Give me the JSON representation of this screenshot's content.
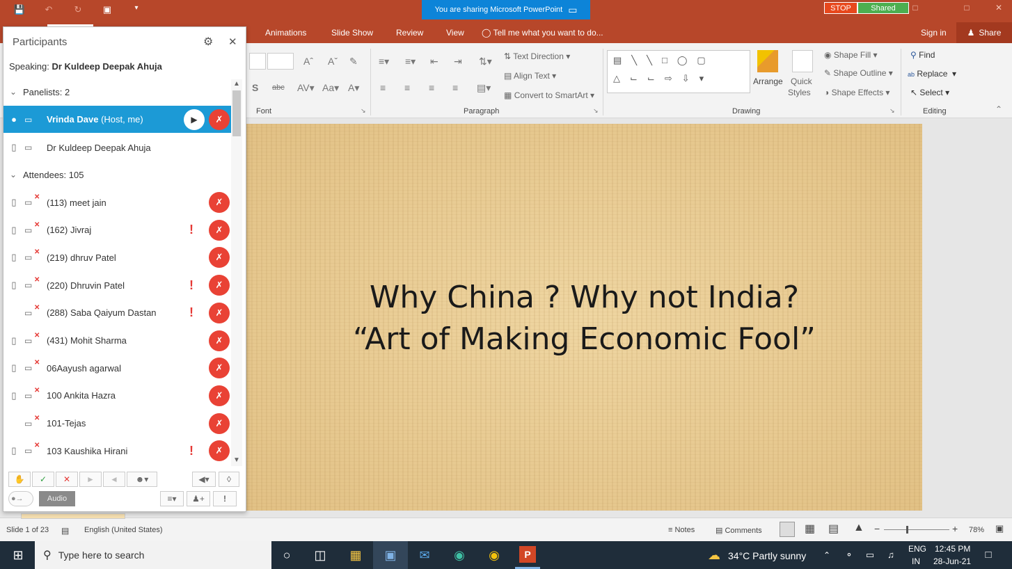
{
  "titlebar": {
    "sharing_banner": "You are sharing Microsoft PowerPoint",
    "stop_label": "STOP",
    "shared_label": "Shared"
  },
  "tabs": [
    "Animations",
    "Slide Show",
    "Review",
    "View"
  ],
  "tell_me": "Tell me what you want to do...",
  "sign_in": "Sign in",
  "share": "Share",
  "ribbon": {
    "font_group": "Font",
    "paragraph_group": "Paragraph",
    "drawing_group": "Drawing",
    "editing_group": "Editing",
    "text_direction": "Text Direction",
    "align_text": "Align Text",
    "convert_smartart": "Convert to SmartArt",
    "arrange": "Arrange",
    "quick_styles_1": "Quick",
    "quick_styles_2": "Styles",
    "shape_fill": "Shape Fill",
    "shape_outline": "Shape Outline",
    "shape_effects": "Shape Effects",
    "find": "Find",
    "replace": "Replace",
    "select": "Select"
  },
  "slide": {
    "line1": "Why China ? Why not India?",
    "line2": "“Art of Making Economic Fool”"
  },
  "status": {
    "slide_count": "Slide 1 of 23",
    "language": "English (United States)",
    "notes": "Notes",
    "comments": "Comments",
    "zoom": "78%"
  },
  "taskbar": {
    "search_placeholder": "Type here to search",
    "weather": "34°C  Partly sunny",
    "lang1": "ENG",
    "lang2": "IN",
    "time": "12:45 PM",
    "date": "28-Jun-21"
  },
  "participants": {
    "title": "Participants",
    "speaking_label": "Speaking:",
    "speaking_name": "Dr Kuldeep Deepak Ahuja",
    "panelists_header": "Panelists: 2",
    "attendees_header": "Attendees: 105",
    "host_name": "Vrinda Dave",
    "host_tag": "(Host, me)",
    "panelist2": "Dr Kuldeep Deepak Ahuja",
    "attendees": [
      {
        "name": "(113) meet jain",
        "alert": false
      },
      {
        "name": "(162) Jivraj",
        "alert": true
      },
      {
        "name": "(219) dhruv Patel",
        "alert": false
      },
      {
        "name": "(220) Dhruvin Patel",
        "alert": true
      },
      {
        "name": "(288) Saba Qaiyum Dastan",
        "alert": true
      },
      {
        "name": "(431) Mohit Sharma",
        "alert": false
      },
      {
        "name": "06Aayush agarwal",
        "alert": false
      },
      {
        "name": "100 Ankita Hazra",
        "alert": false
      },
      {
        "name": "101-Tejas",
        "alert": false
      },
      {
        "name": "103 Kaushika Hirani",
        "alert": true
      }
    ],
    "audio_label": "Audio"
  }
}
